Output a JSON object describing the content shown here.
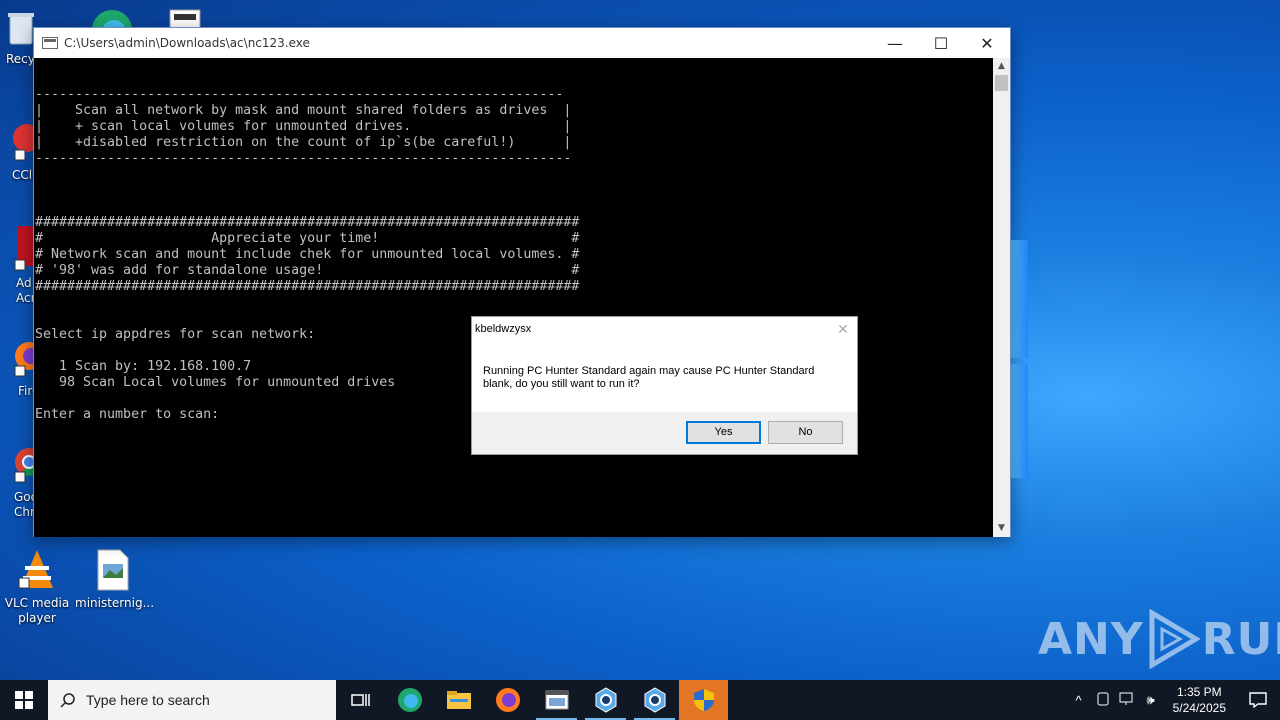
{
  "desktop": {
    "icons": [
      {
        "label": "Recy"
      },
      {
        "label": "CCle"
      },
      {
        "label": "Ad Acr"
      },
      {
        "label": "Fire"
      },
      {
        "label": "Goo Chr"
      },
      {
        "label": "VLC media player"
      },
      {
        "label": "ministernig..."
      }
    ]
  },
  "console": {
    "title": "C:\\Users\\admin\\Downloads\\ac\\nc123.exe",
    "minimize": "—",
    "maximize": "☐",
    "close": "✕",
    "output": "------------------------------------------------------------------\n|    Scan all network by mask and mount shared folders as drives  |\n|    + scan local volumes for unmounted drives.                   |\n|    +disabled restriction on the count of ip`s(be careful!)      |\n-------------------------------------------------------------------\n\n\n\n####################################################################\n#                     Appreciate your time!                        #\n# Network scan and mount include chek for unmounted local volumes. #\n# '98' was add for standalone usage!                               #\n####################################################################\n\n\nSelect ip appdres for scan network:\n\n   1 Scan by: 192.168.100.7\n   98 Scan Local volumes for unmounted drives\n\nEnter a number to scan:"
  },
  "dialog": {
    "title": "kbeldwzysx",
    "message_line1": "Running PC Hunter Standard again may cause PC Hunter Standard",
    "message_line2": "blank, do you still want to run it?",
    "yes": "Yes",
    "no": "No",
    "close": "✕"
  },
  "watermark": {
    "left": "ANY",
    "right": "RUN"
  },
  "taskbar": {
    "search_placeholder": "Type here to search",
    "time": "1:35 PM",
    "date": "5/24/2025"
  }
}
